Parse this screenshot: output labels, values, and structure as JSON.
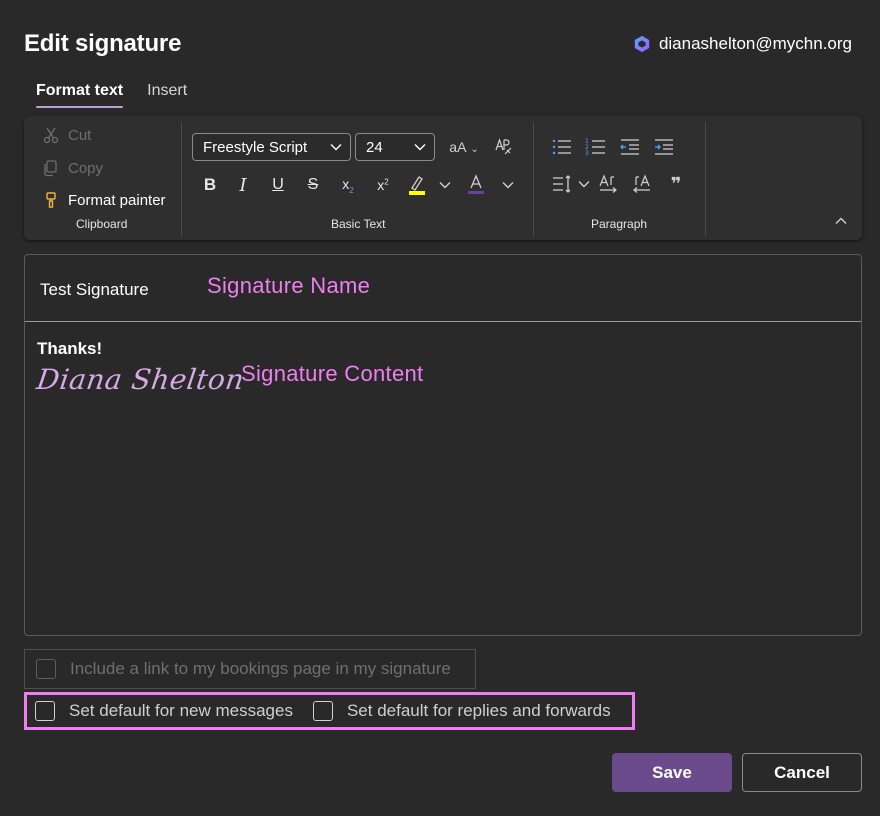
{
  "dialog": {
    "title": "Edit signature",
    "account_email": "dianashelton@mychn.org"
  },
  "tabs": [
    {
      "label": "Format text",
      "active": true
    },
    {
      "label": "Insert",
      "active": false
    }
  ],
  "ribbon": {
    "clipboard": {
      "cut_label": "Cut",
      "copy_label": "Copy",
      "format_painter_label": "Format painter",
      "group_label": "Clipboard"
    },
    "basic_text": {
      "font_family": "Freestyle Script",
      "font_size": "24",
      "group_label": "Basic Text",
      "highlight_color": "#ffff00",
      "font_color": "#6b3fa0"
    },
    "paragraph": {
      "group_label": "Paragraph"
    }
  },
  "signature": {
    "name": "Test Signature",
    "name_annotation": "Signature Name",
    "content_line1": "Thanks!",
    "content_script": "Diana Shelton",
    "content_annotation": "Signature Content"
  },
  "options": {
    "bookings_link_label": "Include a link to my bookings page in my signature",
    "default_new_label": "Set default for new messages",
    "default_replies_label": "Set default for replies and forwards"
  },
  "buttons": {
    "save_label": "Save",
    "cancel_label": "Cancel"
  },
  "colors": {
    "accent": "#6b4a8c",
    "annotation": "#ef7ef1",
    "background": "#292929"
  }
}
